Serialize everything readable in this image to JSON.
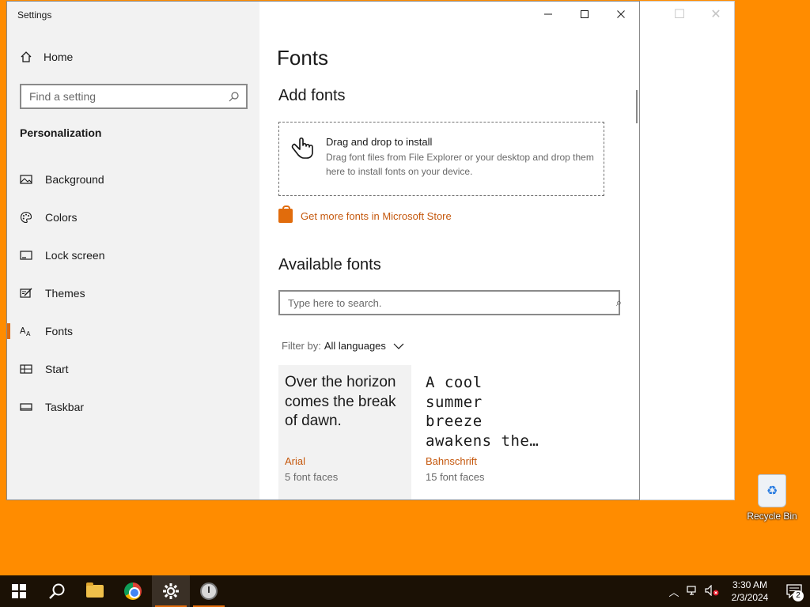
{
  "window": {
    "title": "Settings",
    "controls": {
      "minimize": "—",
      "maximize": "☐",
      "close": "✕"
    }
  },
  "sidebar": {
    "home_label": "Home",
    "search_placeholder": "Find a setting",
    "section_title": "Personalization",
    "items": [
      {
        "label": "Background",
        "icon": "picture-icon"
      },
      {
        "label": "Colors",
        "icon": "palette-icon"
      },
      {
        "label": "Lock screen",
        "icon": "lock-screen-icon"
      },
      {
        "label": "Themes",
        "icon": "themes-icon"
      },
      {
        "label": "Fonts",
        "icon": "fonts-icon",
        "active": true
      },
      {
        "label": "Start",
        "icon": "start-icon"
      },
      {
        "label": "Taskbar",
        "icon": "taskbar-icon"
      }
    ]
  },
  "main": {
    "page_title": "Fonts",
    "add_fonts_heading": "Add fonts",
    "drop_title": "Drag and drop to install",
    "drop_desc": "Drag font files from File Explorer or your desktop and drop them here to install fonts on your device.",
    "store_link": "Get more fonts in Microsoft Store",
    "available_heading": "Available fonts",
    "search_placeholder": "Type here to search.",
    "filter_label": "Filter by:",
    "filter_value": "All languages",
    "fonts": [
      {
        "sample": "Over the horizon comes the break of dawn.",
        "name": "Arial",
        "faces": "5 font faces"
      },
      {
        "sample": "A cool summer breeze awakens the…",
        "name": "Bahnschrift",
        "faces": "15 font faces"
      }
    ]
  },
  "desktop": {
    "recycle_bin_label": "Recycle Bin"
  },
  "taskbar": {
    "time": "3:30 AM",
    "date": "2/3/2024",
    "notification_count": "2"
  },
  "colors": {
    "desktop": "#ff8c00",
    "accent": "#e16c0c"
  }
}
